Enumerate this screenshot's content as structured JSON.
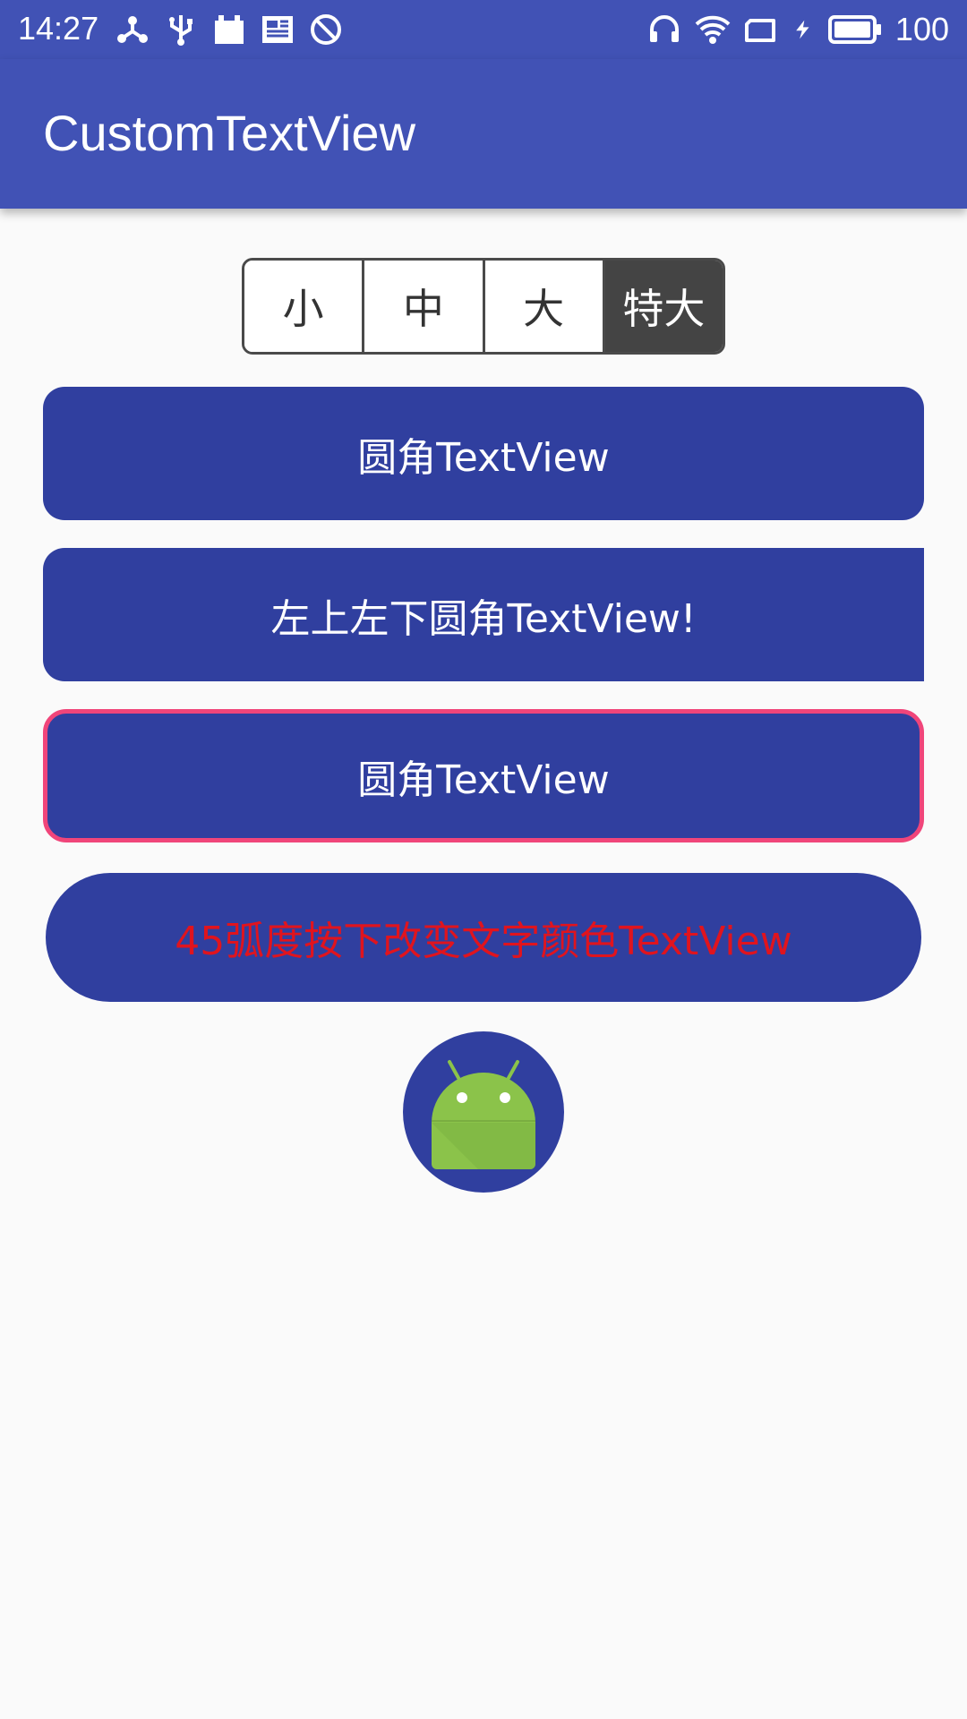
{
  "status_bar": {
    "time": "14:27",
    "left_icons": [
      "share-network-icon",
      "usb-icon",
      "calendar-icon",
      "news-icon",
      "block-icon"
    ],
    "right_icons": [
      "headset-icon",
      "wifi-icon",
      "sim-icon",
      "charging-icon",
      "battery-icon"
    ],
    "battery_level": "100"
  },
  "app_bar": {
    "title": "CustomTextView"
  },
  "size_selector": {
    "options": [
      "小",
      "中",
      "大",
      "特大"
    ],
    "selected": "特大"
  },
  "text_views": [
    {
      "label": "圆角TextView",
      "style": "rounded"
    },
    {
      "label": "左上左下圆角TextView!",
      "style": "left-rounded"
    },
    {
      "label": "圆角TextView",
      "style": "rounded-stroke"
    },
    {
      "label": "45弧度按下改变文字颜色TextView",
      "style": "pill-pressed"
    }
  ],
  "colors": {
    "primary": "#4152b5",
    "button_fill": "#303f9f",
    "stroke": "#f0457a",
    "pressed_text": "#e0141e",
    "selected_segment": "#444444",
    "background": "#fafafa",
    "android_green": "#8bc34a"
  },
  "avatar": {
    "icon": "android-icon"
  }
}
